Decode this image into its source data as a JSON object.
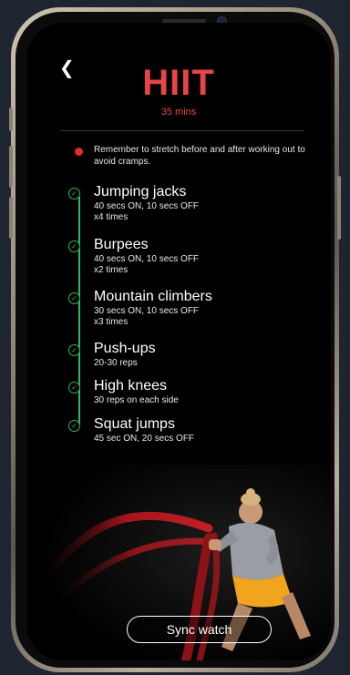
{
  "header": {
    "back_icon": "chevron-left-icon",
    "title": "HIIT",
    "duration": "35 mins"
  },
  "reminder": {
    "icon": "alert-dot-icon",
    "text": "Remember to stretch before and after working out to avoid cramps."
  },
  "exercises": [
    {
      "name": "Jumping jacks",
      "details": [
        "40 secs ON, 10 secs OFF",
        "x4 times"
      ]
    },
    {
      "name": "Burpees",
      "details": [
        "40 secs ON, 10 secs OFF",
        "x2 times"
      ]
    },
    {
      "name": "Mountain climbers",
      "details": [
        "30 secs ON, 10 secs OFF",
        "x3 times"
      ]
    },
    {
      "name": "Push-ups",
      "details": [
        "20-30 reps"
      ]
    },
    {
      "name": "High knees",
      "details": [
        "30 reps on each side"
      ]
    },
    {
      "name": "Squat jumps",
      "details": [
        "45 sec ON, 20 secs OFF"
      ]
    }
  ],
  "footer": {
    "sync_label": "Sync watch"
  },
  "colors": {
    "accent": "#e7444b",
    "check": "#31b65a",
    "background": "#000000"
  }
}
